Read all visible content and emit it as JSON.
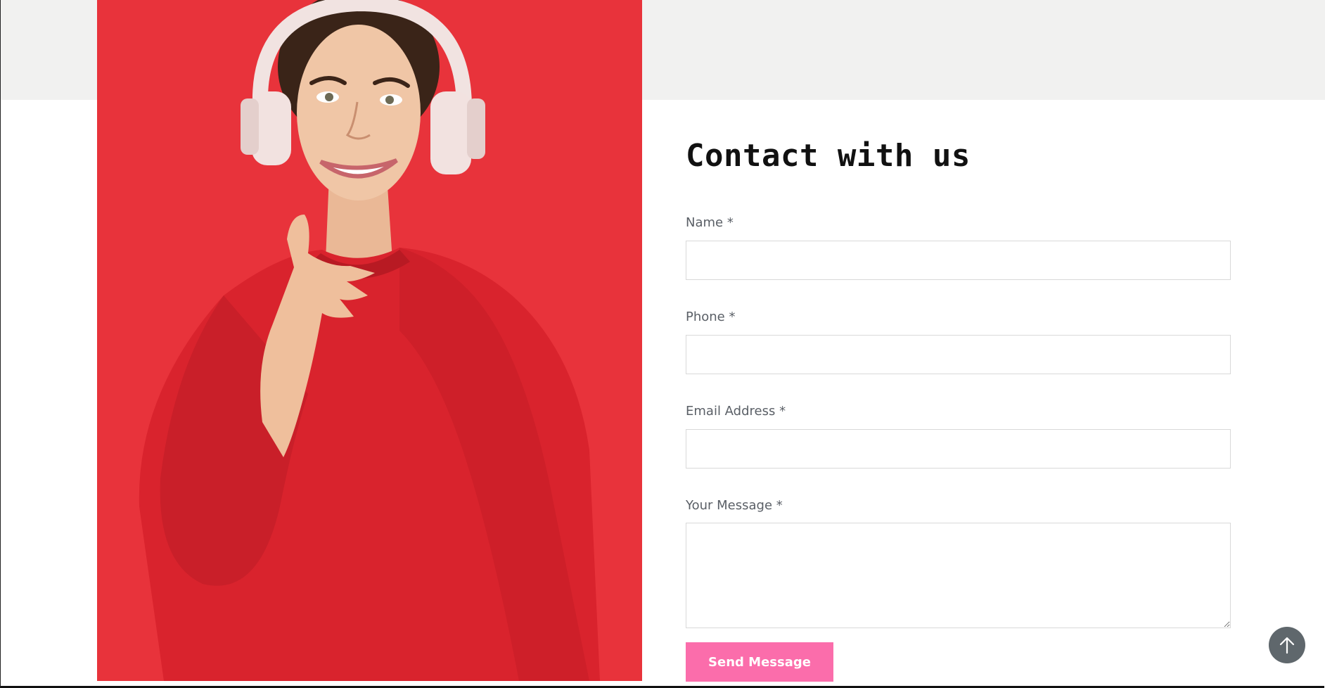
{
  "contact": {
    "title": "Contact with us",
    "fields": [
      {
        "label": "Name *",
        "value": "",
        "placeholder": ""
      },
      {
        "label": "Phone *",
        "value": "",
        "placeholder": ""
      },
      {
        "label": "Email Address *",
        "value": "",
        "placeholder": ""
      },
      {
        "label": "Your Message *",
        "value": "",
        "placeholder": ""
      }
    ],
    "submit_label": "Send Message"
  },
  "hero_image": {
    "subject": "woman-with-headphones-photo",
    "background_color": "#e8333b"
  },
  "scroll_top": {
    "icon": "arrow-up-icon"
  },
  "colors": {
    "accent": "#fb6dab",
    "top_band": "#f1f1f0",
    "scroll_button": "#5f676c"
  }
}
